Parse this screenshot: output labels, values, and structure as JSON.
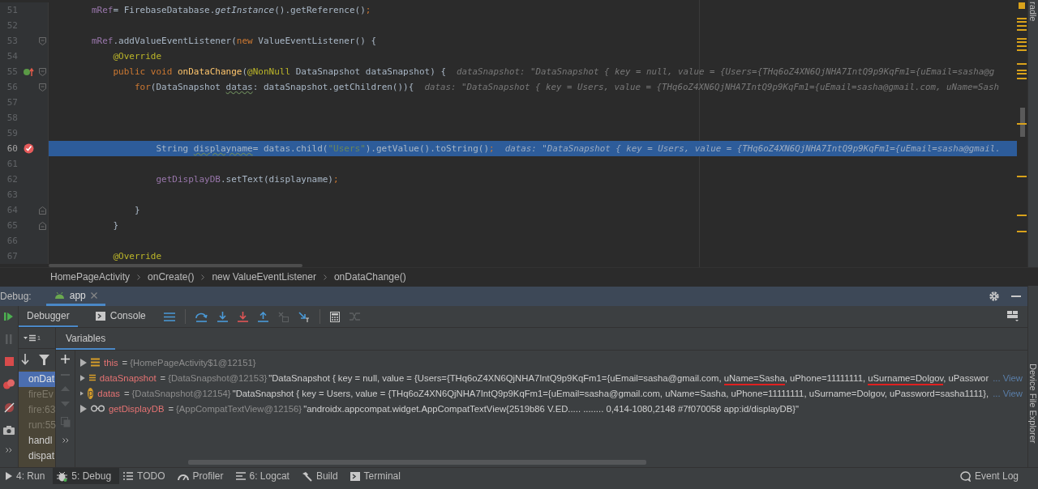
{
  "editor": {
    "lines": [
      {
        "number": "51",
        "current": false,
        "tokens": [
          {
            "kind": "field",
            "text": "        mRef"
          },
          {
            "kind": "plain",
            "text": "= FirebaseDatabase."
          },
          {
            "kind": "italic",
            "text": "getInstance"
          },
          {
            "kind": "plain",
            "text": "().getReference()"
          },
          {
            "kind": "kw",
            "text": ";"
          }
        ]
      },
      {
        "number": "52",
        "current": false
      },
      {
        "number": "53",
        "current": false,
        "markers": [
          {
            "kind": "fold_open"
          }
        ],
        "tokens": [
          {
            "kind": "field",
            "text": "        mRef"
          },
          {
            "kind": "plain",
            "text": ".addValueEventListener("
          },
          {
            "kind": "kw",
            "text": "new"
          },
          {
            "kind": "plain",
            "text": " ValueEventListener() {"
          }
        ]
      },
      {
        "number": "54",
        "current": false,
        "tokens": [
          {
            "kind": "ann",
            "text": "            @Override"
          }
        ]
      },
      {
        "number": "55",
        "current": false,
        "markers": [
          {
            "kind": "override"
          },
          {
            "kind": "fold_open"
          }
        ],
        "tokens": [
          {
            "kind": "kw",
            "text": "            public void "
          },
          {
            "kind": "method",
            "text": "onDataChange"
          },
          {
            "kind": "plain",
            "text": "("
          },
          {
            "kind": "ann",
            "text": "@NonNull"
          },
          {
            "kind": "plain",
            "text": " DataSnapshot dataSnapshot) {"
          }
        ],
        "hint": "dataSnapshot: \"DataSnapshot { key = null, value = {Users={THq6oZ4XN6QjNHA7IntQ9p9KqFm1={uEmail=sasha@g"
      },
      {
        "number": "56",
        "current": false,
        "markers": [
          {
            "kind": "fold_open"
          }
        ],
        "tokens": [
          {
            "kind": "kw",
            "text": "                for"
          },
          {
            "kind": "plain",
            "text": "(DataSnapshot "
          },
          {
            "kind": "warn",
            "text": "datas"
          },
          {
            "kind": "plain",
            "text": ": dataSnapshot.getChildren()){"
          }
        ],
        "hint": "datas: \"DataSnapshot { key = Users, value = {THq6oZ4XN6QjNHA7IntQ9p9KqFm1={uEmail=sasha@gmail.com, uName=Sash"
      },
      {
        "number": "57",
        "current": false
      },
      {
        "number": "58",
        "current": false
      },
      {
        "number": "59",
        "current": false
      },
      {
        "number": "60",
        "current": true,
        "markers": [
          {
            "kind": "breakpoint"
          }
        ],
        "tokens": [
          {
            "kind": "plain",
            "text": "                    String "
          },
          {
            "kind": "warn",
            "text": "displayname"
          },
          {
            "kind": "plain",
            "text": "= datas.child("
          },
          {
            "kind": "str",
            "text": "\"Users\""
          },
          {
            "kind": "plain",
            "text": ").getValue().toString()"
          },
          {
            "kind": "kw",
            "text": ";"
          }
        ],
        "hint": "datas: \"DataSnapshot { key = Users, value = {THq6oZ4XN6QjNHA7IntQ9p9KqFm1={uEmail=sasha@gmail."
      },
      {
        "number": "61",
        "current": false
      },
      {
        "number": "62",
        "current": false,
        "tokens": [
          {
            "kind": "field",
            "text": "                    getDisplayDB"
          },
          {
            "kind": "plain",
            "text": ".setText(displayname)"
          },
          {
            "kind": "kw",
            "text": ";"
          }
        ]
      },
      {
        "number": "63",
        "current": false
      },
      {
        "number": "64",
        "current": false,
        "markers": [
          {
            "kind": "fold_close"
          }
        ],
        "tokens": [
          {
            "kind": "plain",
            "text": "                }"
          }
        ]
      },
      {
        "number": "65",
        "current": false,
        "markers": [
          {
            "kind": "fold_close"
          }
        ],
        "tokens": [
          {
            "kind": "plain",
            "text": "            }"
          }
        ]
      },
      {
        "number": "66",
        "current": false
      },
      {
        "number": "67",
        "current": false,
        "tokens": [
          {
            "kind": "ann",
            "text": "            @Override"
          }
        ]
      }
    ]
  },
  "side_tabs": {
    "top": "radle",
    "bottom": "Device File Explorer"
  },
  "breadcrumbs": [
    "HomePageActivity",
    "onCreate()",
    "new ValueEventListener",
    "onDataChange()"
  ],
  "debug": {
    "label": "Debug:",
    "tabs": [
      {
        "label": "app",
        "selected": true
      }
    ],
    "subtabs": [
      {
        "label": "Debugger",
        "selected": true,
        "kind": "plain"
      },
      {
        "label": "Console",
        "selected": false,
        "kind": "console"
      }
    ],
    "frames": {
      "thread_count": "1",
      "items": [
        {
          "label": "onDat",
          "selected": true,
          "dimmed": false
        },
        {
          "label": "fireEv",
          "selected": false,
          "dimmed": true
        },
        {
          "label": "fire:63",
          "selected": false,
          "dimmed": true
        },
        {
          "label": "run:55",
          "selected": false,
          "dimmed": true
        },
        {
          "label": "handl",
          "selected": false,
          "dimmed": false
        },
        {
          "label": "dispat",
          "selected": false,
          "dimmed": false
        }
      ]
    },
    "variables": {
      "tab": "Variables",
      "rows": [
        {
          "kind": "field",
          "name": "this",
          "equals": "=",
          "ref": "{HomePageActivity$1@12151}"
        },
        {
          "kind": "field",
          "name": "dataSnapshot",
          "equals": "=",
          "ref": "{DataSnapshot@12153}",
          "value": [
            {
              "text": "\"DataSnapshot { key = null, value = {Users={THq6oZ4XN6QjNHA7IntQ9p9KqFm1={uEmail=sasha@gmail.com, ",
              "marked": false
            },
            {
              "text": "uName=Sasha",
              "marked": true
            },
            {
              "text": ", uPhone=11111111, ",
              "marked": false
            },
            {
              "text": "uSurname=Dolgov",
              "marked": true
            },
            {
              "text": ", uPasswor",
              "marked": false
            }
          ],
          "link": "... View"
        },
        {
          "kind": "param",
          "icon_letter": "p",
          "name": "datas",
          "equals": "=",
          "ref": "{DataSnapshot@12154}",
          "value": [
            {
              "text": "\"DataSnapshot { key = Users, value = {THq6oZ4XN6QjNHA7IntQ9p9KqFm1={uEmail=sasha@gmail.com, uName=Sasha, uPhone=11111111, uSurname=Dolgov, uPassword=sasha1111},",
              "marked": false
            }
          ],
          "link": "... View"
        },
        {
          "kind": "watch",
          "name": "getDisplayDB",
          "equals": "=",
          "ref": "{AppCompatTextView@12156}",
          "value": [
            {
              "text": "\"androidx.appcompat.widget.AppCompatTextView{2519b86 V.ED..... ........ 0,414-1080,2148 #7f070058 app:id/displayDB}\"",
              "marked": false
            }
          ]
        }
      ]
    }
  },
  "tool_tabs": [
    {
      "label": "4: Run",
      "kind": "run",
      "selected": false
    },
    {
      "label": "5: Debug",
      "kind": "debug",
      "selected": true
    },
    {
      "label": "TODO",
      "kind": "todo",
      "selected": false
    },
    {
      "label": "Profiler",
      "kind": "profiler",
      "selected": false
    },
    {
      "label": "6: Logcat",
      "kind": "logcat",
      "selected": false
    },
    {
      "label": "Build",
      "kind": "build",
      "selected": false
    },
    {
      "label": "Terminal",
      "kind": "terminal",
      "selected": false
    }
  ],
  "event_log": "Event Log"
}
